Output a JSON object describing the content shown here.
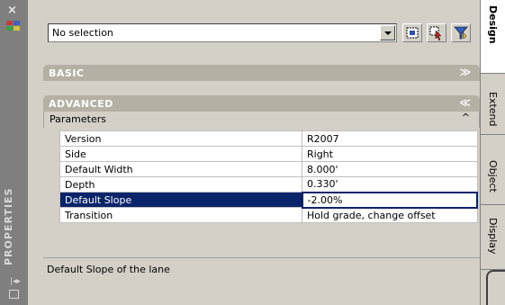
{
  "palette": {
    "title": "PROPERTIES",
    "close_glyph": "×",
    "options_icon": "properties-options-icon",
    "autohide_glyph": "|◂▸",
    "menu_icon": "properties-menu-icon"
  },
  "toolbar": {
    "selection_value": "No selection",
    "buttons": [
      {
        "icon": "toggle-pickadd-icon"
      },
      {
        "icon": "select-objects-icon"
      },
      {
        "icon": "quick-select-icon"
      }
    ]
  },
  "sections": {
    "basic": {
      "label": "BASIC",
      "chevron": "≫"
    },
    "advanced": {
      "label": "ADVANCED",
      "chevron": "≪"
    }
  },
  "parameters": {
    "label": "Parameters",
    "chevron": "^",
    "rows": [
      {
        "name": "Version",
        "value": "R2007"
      },
      {
        "name": "Side",
        "value": "Right"
      },
      {
        "name": "Default Width",
        "value": "8.000'"
      },
      {
        "name": "Depth",
        "value": "0.330'"
      },
      {
        "name": "Default Slope",
        "value": "-2.00%"
      },
      {
        "name": "Transition",
        "value": "Hold grade, change offset"
      }
    ]
  },
  "description": "Default Slope of the lane",
  "tabs": [
    "Design",
    "Extend",
    "Object",
    "Display"
  ],
  "colors": {
    "panel": "#d4d0c8",
    "section_header": "#b5b0a4",
    "selection": "#0a246a",
    "titlebar": "#7f7f7f"
  }
}
